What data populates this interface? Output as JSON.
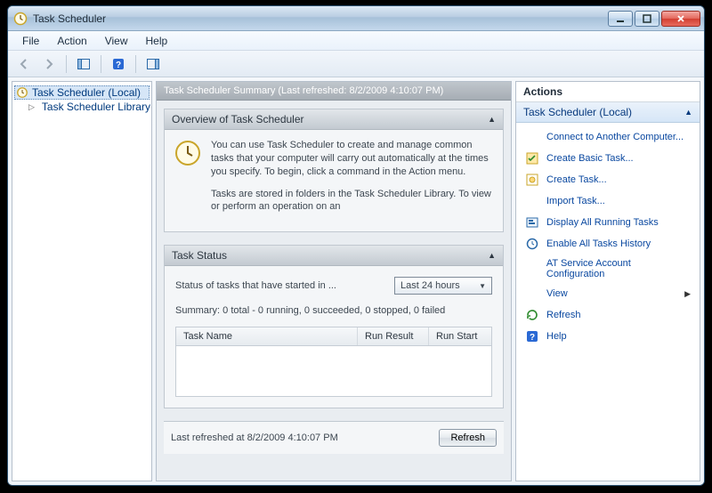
{
  "window": {
    "title": "Task Scheduler"
  },
  "menus": {
    "file": "File",
    "action": "Action",
    "view": "View",
    "help": "Help"
  },
  "tree": {
    "root": "Task Scheduler (Local)",
    "child": "Task Scheduler Library"
  },
  "main": {
    "header": "Task Scheduler Summary (Last refreshed: 8/2/2009 4:10:07 PM)",
    "overview": {
      "title": "Overview of Task Scheduler",
      "p1": "You can use Task Scheduler to create and manage common tasks that your computer will carry out automatically at the times you specify. To begin, click a command in the Action menu.",
      "p2": "Tasks are stored in folders in the Task Scheduler Library. To view or perform an operation on an"
    },
    "status": {
      "title": "Task Status",
      "label": "Status of tasks that have started in ...",
      "dropdown": "Last 24 hours",
      "summary": "Summary: 0 total - 0 running, 0 succeeded, 0 stopped, 0 failed",
      "columns": {
        "name": "Task Name",
        "result": "Run Result",
        "start": "Run Start"
      }
    },
    "footer": {
      "text": "Last refreshed at 8/2/2009 4:10:07 PM",
      "refresh": "Refresh"
    }
  },
  "actions": {
    "title": "Actions",
    "scope": "Task Scheduler (Local)",
    "items": [
      "Connect to Another Computer...",
      "Create Basic Task...",
      "Create Task...",
      "Import Task...",
      "Display All Running Tasks",
      "Enable All Tasks History",
      "AT Service Account Configuration",
      "View",
      "Refresh",
      "Help"
    ]
  }
}
